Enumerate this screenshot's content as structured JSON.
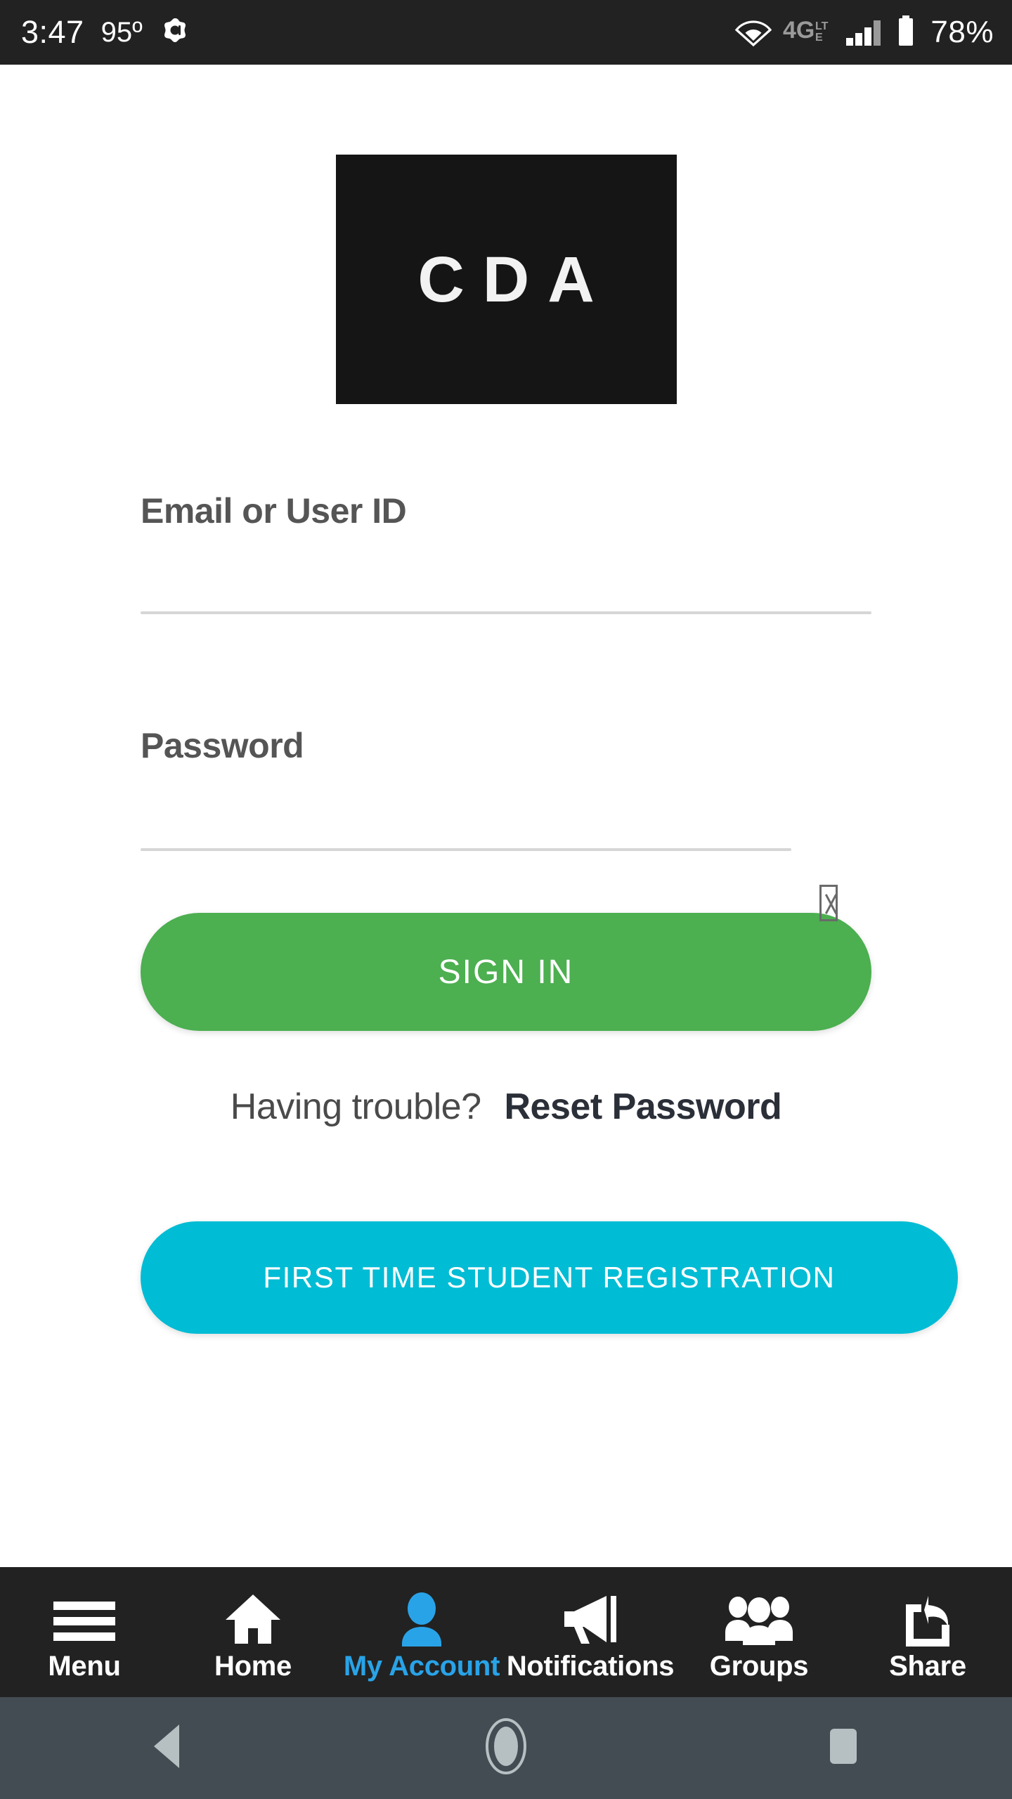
{
  "status_bar": {
    "time": "3:47",
    "temperature": "95º",
    "app_icon": "amazon-alexa-icon",
    "wifi_icon": "wifi-icon",
    "network_type": "4G",
    "network_suffix": "LTE",
    "signal_icon": "signal-bars-icon",
    "battery_icon": "battery-icon",
    "battery_percent": "78%",
    "background_color": "#222222"
  },
  "logo": {
    "text": "CDA",
    "background_color": "#151515",
    "text_color": "#f2f2f2"
  },
  "form": {
    "email": {
      "label": "Email or User ID",
      "value": "",
      "placeholder": ""
    },
    "password": {
      "label": "Password",
      "value": "",
      "placeholder": "",
      "toggle_icon": "missing-glyph-tofu-icon"
    },
    "sign_in_label": "SIGN IN",
    "sign_in_color": "#4CAF50",
    "trouble_question": "Having trouble?",
    "reset_password_label": "Reset Password",
    "register_label": "FIRST TIME STUDENT REGISTRATION",
    "register_color": "#00BCD4"
  },
  "app_nav": {
    "active_color": "#29A3E8",
    "items": [
      {
        "label": "Menu",
        "icon": "hamburger-menu-icon",
        "active": false
      },
      {
        "label": "Home",
        "icon": "home-icon",
        "active": false
      },
      {
        "label": "My Account",
        "icon": "person-icon",
        "active": true
      },
      {
        "label": "Notifications",
        "icon": "megaphone-icon",
        "active": false
      },
      {
        "label": "Groups",
        "icon": "people-group-icon",
        "active": false
      },
      {
        "label": "Share",
        "icon": "share-icon",
        "active": false
      }
    ]
  },
  "system_nav": {
    "background_color": "#434C52",
    "back_icon": "back-triangle-icon",
    "home_icon": "home-circle-icon",
    "recents_icon": "recents-square-icon"
  }
}
